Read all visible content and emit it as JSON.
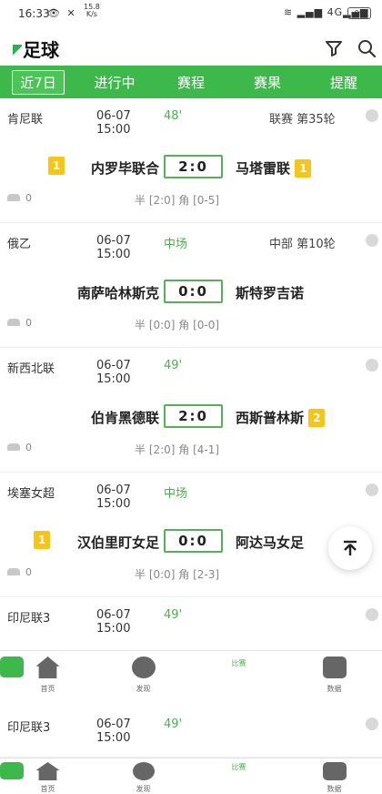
{
  "status_bar": {
    "time": "16:33",
    "speed_value": "15.8",
    "speed_unit": "K/s",
    "signal": "4G",
    "battery": "99"
  },
  "header": {
    "title": "足球"
  },
  "tabs": [
    "近7日",
    "进行中",
    "赛程",
    "赛果",
    "提醒"
  ],
  "matches": [
    {
      "league": "肯尼联",
      "date": "06-07",
      "time": "15:00",
      "status": "48'",
      "round": "联赛 第35轮",
      "home": "内罗毕联合",
      "home_card": "1",
      "score": "2:0",
      "away": "马塔雷联",
      "away_card": "1",
      "people": "0",
      "stats": "半 [2:0]   角 [0-5]"
    },
    {
      "league": "俄乙",
      "date": "06-07",
      "time": "15:00",
      "status": "中场",
      "round": "中部 第10轮",
      "home": "南萨哈林斯克",
      "home_card": "",
      "score": "0:0",
      "away": "斯特罗吉诺",
      "away_card": "",
      "people": "0",
      "stats": "半 [0:0]   角 [0-0]"
    },
    {
      "league": "新西北联",
      "date": "06-07",
      "time": "15:00",
      "status": "49'",
      "round": "",
      "home": "伯肯黑德联",
      "home_card": "",
      "score": "2:0",
      "away": "西斯普林斯",
      "away_card": "2",
      "people": "0",
      "stats": "半 [2:0]   角 [4-1]"
    },
    {
      "league": "埃塞女超",
      "date": "06-07",
      "time": "15:00",
      "status": "中场",
      "round": "",
      "home": "汉伯里盯女足",
      "home_card": "1",
      "score": "0:0",
      "away": "阿达马女足",
      "away_card": "",
      "people": "0",
      "stats": "半 [0:0]   角 [2-3]"
    },
    {
      "league": "印尼联3",
      "date": "06-07",
      "time": "15:00",
      "status": "49'"
    }
  ],
  "duplicate_match": {
    "league": "印尼联3",
    "date": "06-07",
    "time": "15:00",
    "status": "49'"
  },
  "bottom_nav": [
    {
      "label": "首页",
      "icon": "home-icon"
    },
    {
      "label": "发现",
      "icon": "discover-icon"
    },
    {
      "label": "比赛",
      "icon": "match-icon"
    },
    {
      "label": "数据",
      "icon": "data-icon"
    }
  ],
  "back_to_top_icon": "arrow-up-icon",
  "colors": {
    "accent": "#3db84a",
    "card": "#f5c518",
    "live": "#4caf50"
  }
}
